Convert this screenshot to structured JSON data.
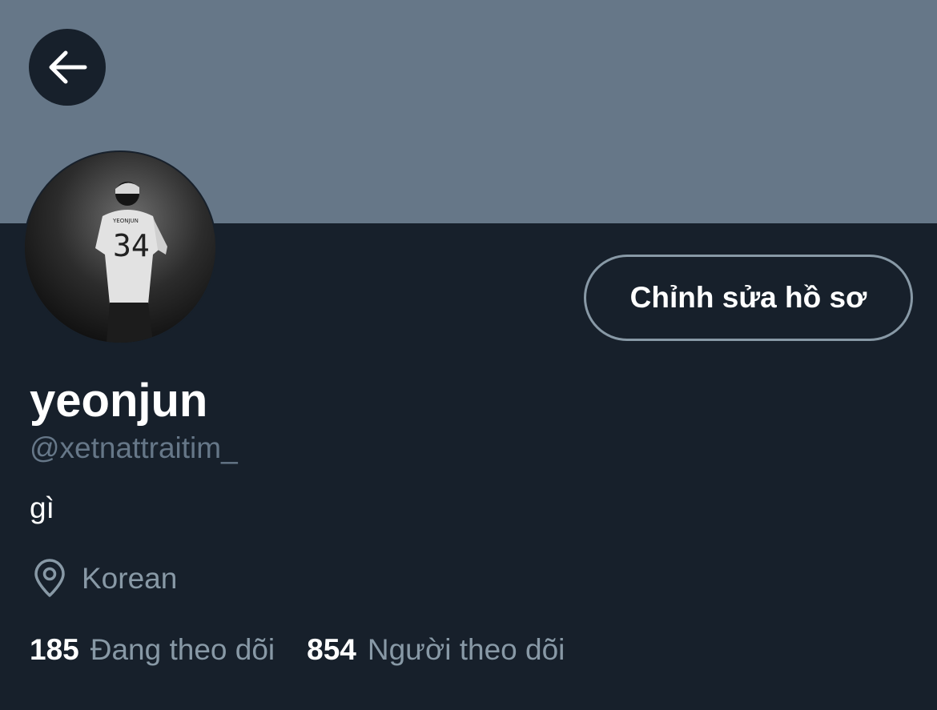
{
  "colors": {
    "background": "#17202b",
    "banner": "#667788",
    "secondary_text": "#8899a6",
    "primary_text": "#ffffff"
  },
  "header": {
    "back_icon": "arrow-left-icon"
  },
  "avatar": {
    "jersey_name": "YEONJUN",
    "jersey_number": "34"
  },
  "actions": {
    "edit_profile_label": "Chỉnh sửa hồ sơ"
  },
  "profile": {
    "display_name": "yeonjun",
    "handle": "@xetnattraitim_",
    "bio": "gì",
    "location_icon": "location-pin-icon",
    "location": "Korean"
  },
  "stats": {
    "following_count": "185",
    "following_label": "Đang theo dõi",
    "followers_count": "854",
    "followers_label": "Người theo dõi"
  }
}
